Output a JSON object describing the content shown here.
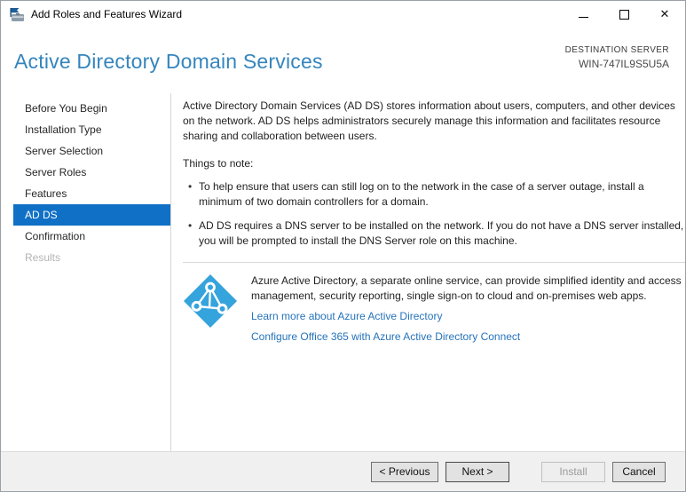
{
  "window": {
    "title": "Add Roles and Features Wizard",
    "controls": {
      "minimize_icon": "minimize",
      "maximize_icon": "maximize",
      "close_glyph": "✕"
    }
  },
  "header": {
    "title": "Active Directory Domain Services",
    "destination_label": "DESTINATION SERVER",
    "destination_server": "WIN-747IL9S5U5A"
  },
  "sidebar": {
    "items": [
      {
        "label": "Before You Begin",
        "state": "normal"
      },
      {
        "label": "Installation Type",
        "state": "normal"
      },
      {
        "label": "Server Selection",
        "state": "normal"
      },
      {
        "label": "Server Roles",
        "state": "normal"
      },
      {
        "label": "Features",
        "state": "normal"
      },
      {
        "label": "AD DS",
        "state": "active"
      },
      {
        "label": "Confirmation",
        "state": "normal"
      },
      {
        "label": "Results",
        "state": "disabled"
      }
    ]
  },
  "content": {
    "intro": "Active Directory Domain Services (AD DS) stores information about users, computers, and other devices on the network.  AD DS helps administrators securely manage this information and facilitates resource sharing and collaboration between users.",
    "things_to_note": "Things to note:",
    "bullets": [
      "To help ensure that users can still log on to the network in the case of a server outage, install a minimum of two domain controllers for a domain.",
      "AD DS requires a DNS server to be installed on the network.  If you do not have a DNS server installed, you will be prompted to install the DNS Server role on this machine."
    ],
    "azure": {
      "icon": "azure-active-directory-icon",
      "description": "Azure Active Directory, a separate online service, can provide simplified identity and access management, security reporting, single sign-on to cloud and on-premises web apps.",
      "links": [
        {
          "label": "Learn more about Azure Active Directory"
        },
        {
          "label": "Configure Office 365 with Azure Active Directory Connect"
        }
      ]
    }
  },
  "footer": {
    "buttons": [
      {
        "label": "< Previous",
        "state": "enabled"
      },
      {
        "label": "Next >",
        "state": "enabled",
        "default": true
      },
      {
        "label": "Install",
        "state": "disabled"
      },
      {
        "label": "Cancel",
        "state": "enabled"
      }
    ]
  },
  "colors": {
    "heading_blue": "#3585bd",
    "sidebar_selected_bg": "#1070c6",
    "link_blue": "#2673ba",
    "azure_icon_blue": "#35a3dc",
    "footer_bg": "#f0f0f0"
  }
}
